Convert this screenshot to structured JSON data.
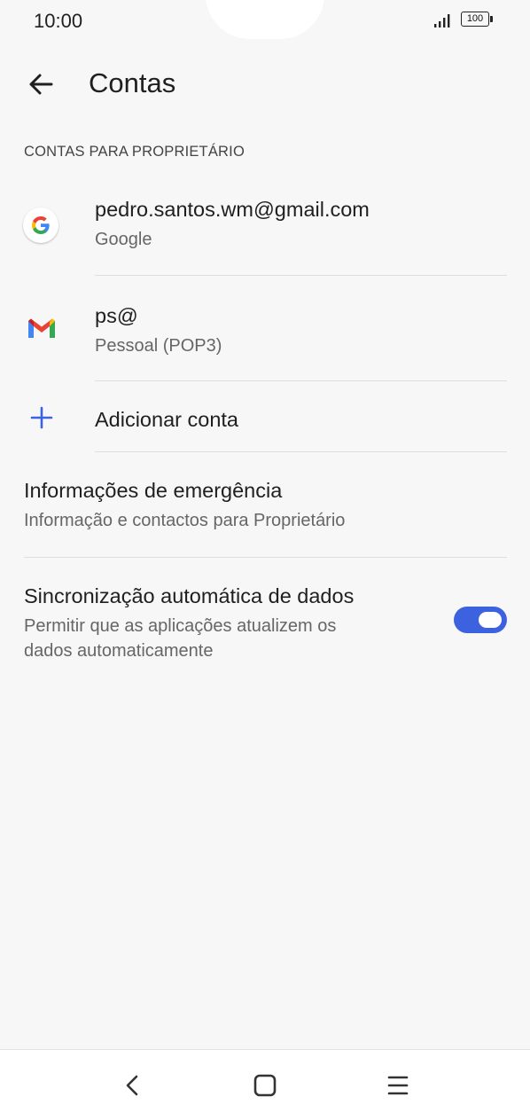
{
  "status_bar": {
    "time": "10:00",
    "battery": "100",
    "icons": [
      "signal-icon",
      "battery-icon"
    ]
  },
  "header": {
    "title": "Contas",
    "back_icon": "arrow-left-icon"
  },
  "accounts_section": {
    "header": "CONTAS PARA PROPRIETÁRIO",
    "accounts": [
      {
        "title": "pedro.santos.wm@gmail.com",
        "subtitle": "Google",
        "icon": "google-icon"
      },
      {
        "title": "ps@",
        "subtitle": "Pessoal (POP3)",
        "icon": "gmail-icon"
      }
    ],
    "add_account": {
      "label": "Adicionar conta",
      "icon": "plus-icon"
    }
  },
  "emergency": {
    "title": "Informações de emergência",
    "subtitle": "Informação e contactos para Proprietário"
  },
  "auto_sync": {
    "title": "Sincronização automática de dados",
    "subtitle_line1": "Permitir que as aplicações atualizem os",
    "subtitle_line2": "dados automaticamente",
    "enabled": true
  },
  "nav_bar": {
    "icons": [
      "back-nav-icon",
      "home-nav-icon",
      "recents-nav-icon"
    ]
  },
  "colors": {
    "background": "#f7f7f7",
    "accent": "#3c62e0",
    "add_icon": "#3c62e0",
    "text_primary": "#1f1f1f",
    "text_secondary": "#666666"
  }
}
